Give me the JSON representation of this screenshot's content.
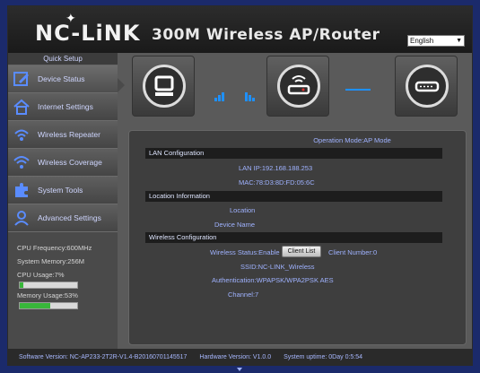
{
  "header": {
    "logo": "NC-LiNK",
    "title": "300M Wireless AP/Router",
    "language": "English"
  },
  "sidebar": {
    "quick_setup": "Quick Setup",
    "items": [
      {
        "label": "Device Status",
        "icon": "edit-icon"
      },
      {
        "label": "Internet Settings",
        "icon": "home-icon"
      },
      {
        "label": "Wireless Repeater",
        "icon": "wifi-repeater-icon"
      },
      {
        "label": "Wireless Coverage",
        "icon": "wifi-icon"
      },
      {
        "label": "System Tools",
        "icon": "puzzle-icon"
      },
      {
        "label": "Advanced Settings",
        "icon": "user-icon"
      }
    ],
    "system": {
      "cpu_freq": "CPU Frequency:600MHz",
      "memory": "System Memory:256M",
      "cpu_usage": "CPU Usage:7%",
      "cpu_bar_percent": 7,
      "memory_usage": "Memory Usage:53%",
      "memory_bar_percent": 53
    }
  },
  "diagram": {
    "nodes": [
      "computer-icon",
      "router-icon",
      "modem-icon"
    ],
    "link_color": "#1e90ff"
  },
  "main": {
    "operation_mode": "Operation Mode:AP Mode",
    "sections": {
      "lan": "LAN Configuration",
      "location": "Location Information",
      "wireless": "Wireless Configuration"
    },
    "lan": {
      "ip": "LAN IP:192.168.188.253",
      "mac": "MAC:78:D3:8D:FD:05:6C"
    },
    "location": {
      "location_label": "Location",
      "device_name_label": "Device Name"
    },
    "wireless": {
      "status": "Wireless Status:Enable",
      "client_list_button": "Client List",
      "client_number": "Client Number:0",
      "ssid": "SSID:NC-LINK_Wireless",
      "authentication": "Authentication:WPAPSK/WPA2PSK AES",
      "channel": "Channel:7"
    }
  },
  "footer": {
    "software_version": "Software Version: NC-AP233-2T2R-V1.4-B20160701145517",
    "hardware_version": "Hardware Version: V1.0.0",
    "system_uptime": "System uptime: 0Day 0:5:54"
  },
  "colors": {
    "link_blue": "#9fb2ff",
    "accent_blue": "#1e90ff",
    "progress_green": "#38b63a"
  }
}
